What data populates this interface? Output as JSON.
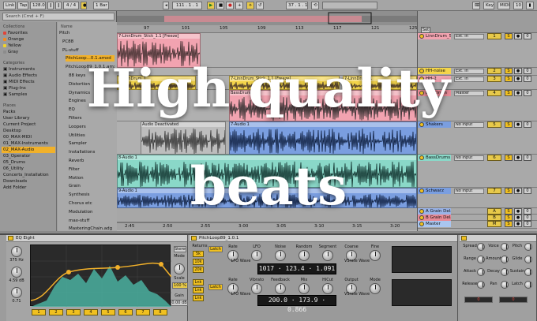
{
  "toolbar": {
    "link": "Link",
    "tap": "Tap",
    "tempo": "128.00",
    "meter": "4 / 4",
    "quant": "1 Bar",
    "position": "111 . 1 . 1",
    "loop_start": "37 . 1 . 1",
    "key": "Key",
    "midi": "MIDI",
    "cpu": "10 %"
  },
  "browser": {
    "search_placeholder": "Search (Cmd + F)",
    "collections_header": "Collections",
    "collections": [
      {
        "label": "Favorites",
        "color": "#e0453a"
      },
      {
        "label": "Orange",
        "color": "#f08a24"
      },
      {
        "label": "Yellow",
        "color": "#f0d22a"
      },
      {
        "label": "Gray",
        "color": "#8c8c8c"
      }
    ],
    "categories_header": "Categories",
    "categories": [
      "Instruments",
      "Audio Effects",
      "MIDI Effects",
      "Plug-Ins",
      "Samples"
    ],
    "places_header": "Places",
    "places": [
      "Packs",
      "User Library",
      "Current Project",
      "Desktop",
      "00_MAX-MIDI",
      "01_MAX-Instruments",
      "02_MAX-Audio",
      "03_Operator",
      "05_Drums",
      "06_Utility",
      "Concerts_Installation",
      "Downloads",
      "Add Folder"
    ],
    "files_header": "Name",
    "files": [
      "Pitch",
      "PC88",
      "PL-stuff",
      "PitchLoop...0.1.amxd",
      "PitchLoop89_1.0.1.amxd",
      "88 keys",
      "Distortion",
      "Dynamics",
      "Engines",
      "EQ",
      "Filters",
      "Loopers",
      "Utilities",
      "Sampler",
      "Installations",
      "Reverb",
      "Filter",
      "Motion",
      "Grain",
      "Synthesis",
      "Chorus etc",
      "Modulation",
      "max-stuff",
      "MasteringChain.adg"
    ]
  },
  "arrangement": {
    "ruler": [
      "97",
      "101",
      "105",
      "109",
      "113",
      "117",
      "121",
      "125"
    ],
    "time": [
      "2:45",
      "2:50",
      "2:55",
      "3:00",
      "3:05",
      "3:10",
      "3:15",
      "3:20"
    ],
    "clips": [
      {
        "label": "7-LinnDrum_Stick_1.1 [Freeze]"
      },
      {
        "label": "7-LinnDrum_1"
      },
      {
        "label": "7-LinnDrum_Stick_1.1 [Freeze]"
      },
      {
        "label": "7-LinnDrum_1"
      },
      {
        "label": "BassDrum"
      },
      {
        "label": "7-Audio 1"
      },
      {
        "label": "Audio Deactivated"
      },
      {
        "label": "8-Audio 1"
      },
      {
        "label": "9-Audio 1"
      }
    ]
  },
  "mixer": {
    "tracks": [
      {
        "name": "LinnDrum_5",
        "color": "#f2a3b0",
        "input": "Ext. In",
        "n": "1"
      },
      {
        "name": "HH-noise",
        "color": "#f4d54a",
        "input": "Ext. In",
        "n": "2"
      },
      {
        "name": "HH-2",
        "color": "#f2a3b0",
        "input": "Ext. In",
        "n": "3"
      },
      {
        "name": "LinnDrum",
        "color": "#e88a96",
        "input": "Master",
        "n": "4"
      },
      {
        "name": "Shakers",
        "color": "#7a9ee0",
        "input": "No Input",
        "n": "5"
      },
      {
        "name": "BassDrums",
        "color": "#8ad8c8",
        "input": "No Input",
        "n": "6"
      },
      {
        "name": "Schwarz",
        "color": "#7a9ee0",
        "input": "No Input",
        "n": "7"
      },
      {
        "name": "A Grain Dela",
        "color": "#9ab4e8",
        "input": "",
        "n": "A"
      },
      {
        "name": "B Grain Dela",
        "color": "#e88a96",
        "input": "",
        "n": "B"
      },
      {
        "name": "Master",
        "color": "#a9c6f0",
        "input": "",
        "n": "M"
      }
    ]
  },
  "devices": {
    "eq_title": "EQ Eight",
    "eq_labels": [
      "Freq",
      "Gain",
      "Q",
      "Mode",
      "Scale",
      "Gain"
    ],
    "eq_values": [
      "375 Hz",
      "4.59 dB",
      "0.71",
      "Stereo",
      "100 %",
      "0.00 dB"
    ],
    "eq_bands": [
      "1",
      "2",
      "3",
      "4",
      "5",
      "6",
      "7",
      "8"
    ],
    "pitch_title": "PitchLoop89_1.0.1",
    "returns_label": "Returns",
    "latch_label": "Latch",
    "lcd_top": [
      "1017",
      "123.4",
      "1.091"
    ],
    "lcd_bottom": [
      "200.0",
      "173.9",
      "0.866"
    ],
    "knob_labels": [
      "Rate",
      "LFO",
      "Noise",
      "Random",
      "Segment",
      "Coarse",
      "Fine",
      "Rate",
      "Vibrato",
      "Feedback",
      "Mix",
      "HiCut",
      "Output",
      "Mode"
    ],
    "lfo_wave": "LFO Wave",
    "vs_wave": "VSrate Wave",
    "right_labels": [
      "Spread",
      "Voice",
      "Pitch",
      "Range",
      "Amount",
      "Glide",
      "Attack",
      "Decay",
      "Sustain",
      "Release",
      "Pan",
      "Latch"
    ],
    "right_values": [
      "0",
      "0"
    ]
  },
  "overlay": {
    "line1": "High quality",
    "line2": "beats"
  }
}
